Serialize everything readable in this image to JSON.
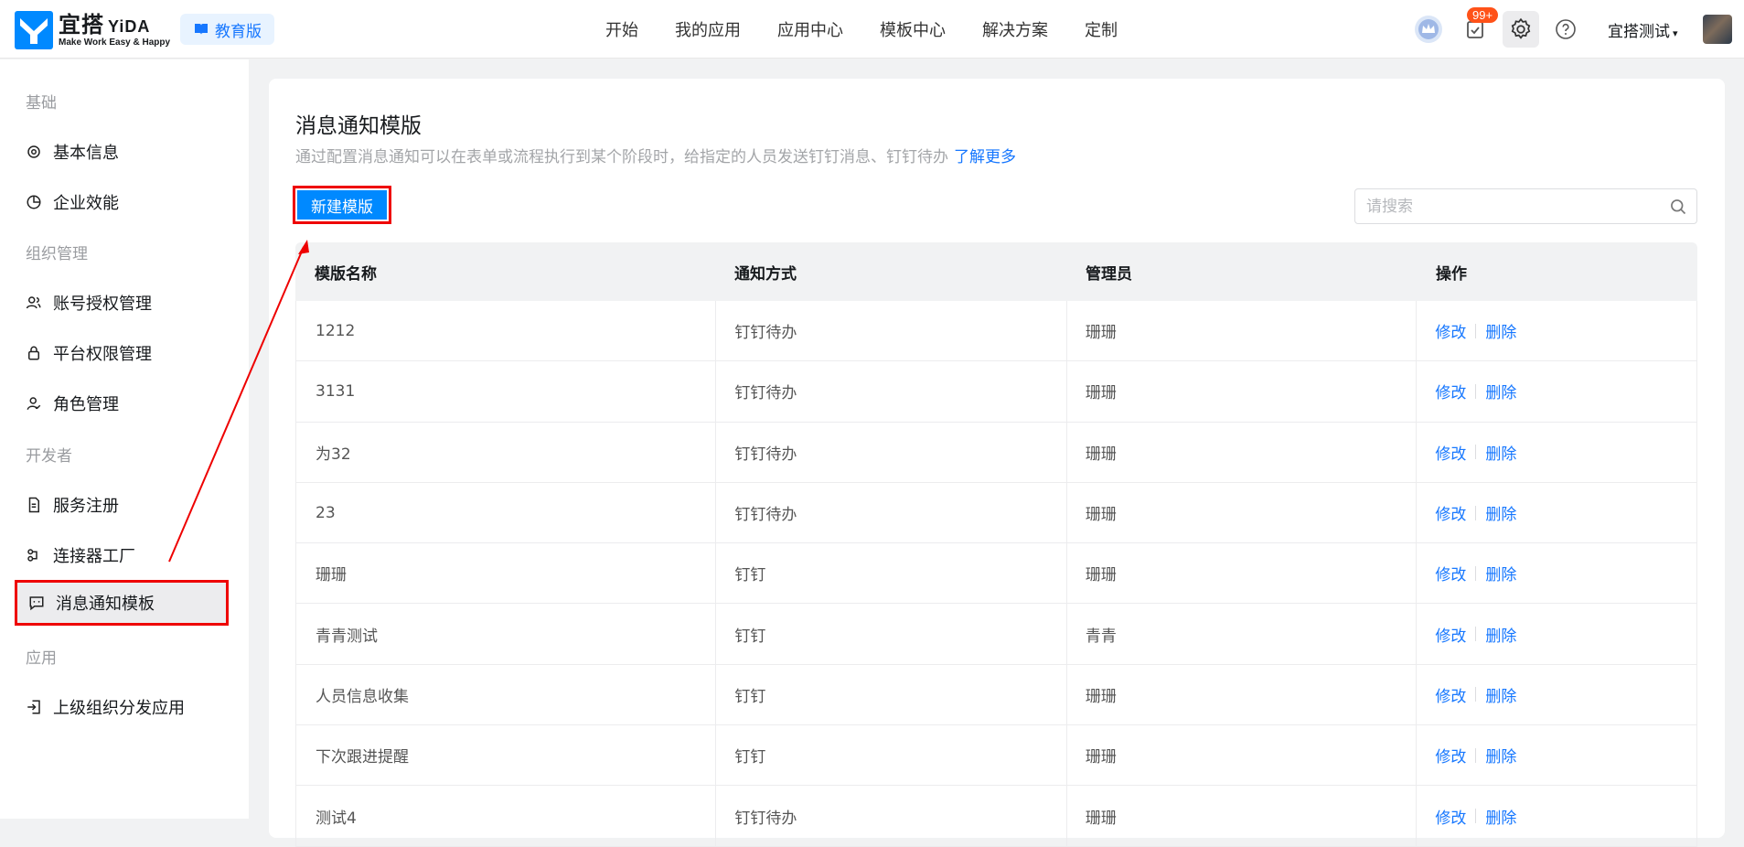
{
  "brand": {
    "cn": "宜搭",
    "en": "YiDA",
    "slogan": "Make Work Easy & Happy",
    "edition": "教育版"
  },
  "nav": [
    "开始",
    "我的应用",
    "应用中心",
    "模板中心",
    "解决方案",
    "定制"
  ],
  "header": {
    "badge": "99+",
    "user": "宜搭测试"
  },
  "sidebar": {
    "groups": {
      "basic": "基础",
      "org": "组织管理",
      "dev": "开发者",
      "app": "应用"
    },
    "items": {
      "info": "基本信息",
      "efficiency": "企业效能",
      "account": "账号授权管理",
      "perm": "平台权限管理",
      "role": "角色管理",
      "service": "服务注册",
      "connector": "连接器工厂",
      "notify": "消息通知模板",
      "distribute": "上级组织分发应用"
    }
  },
  "page": {
    "title": "消息通知模版",
    "desc": "通过配置消息通知可以在表单或流程执行到某个阶段时，给指定的人员发送钉钉消息、钉钉待办",
    "learn_more": "了解更多",
    "new_button": "新建模版",
    "search_placeholder": "请搜索"
  },
  "table": {
    "headers": [
      "模版名称",
      "通知方式",
      "管理员",
      "操作"
    ],
    "edit": "修改",
    "delete": "删除",
    "rows": [
      [
        "1212",
        "钉钉待办",
        "珊珊"
      ],
      [
        "3131",
        "钉钉待办",
        "珊珊"
      ],
      [
        "为32",
        "钉钉待办",
        "珊珊"
      ],
      [
        "23",
        "钉钉待办",
        "珊珊"
      ],
      [
        "珊珊",
        "钉钉",
        "珊珊"
      ],
      [
        "青青测试",
        "钉钉",
        "青青"
      ],
      [
        "人员信息收集",
        "钉钉",
        "珊珊"
      ],
      [
        "下次跟进提醒",
        "钉钉",
        "珊珊"
      ],
      [
        "测试4",
        "钉钉待办",
        "珊珊"
      ]
    ]
  },
  "colors": {
    "accent": "#1677ff",
    "primary_button": "#0089ff",
    "highlight": "#ee0000"
  }
}
